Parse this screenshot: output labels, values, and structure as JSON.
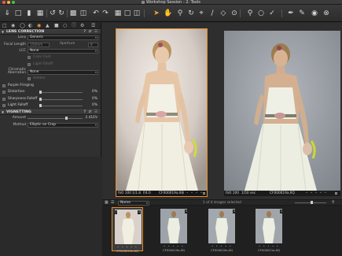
{
  "window": {
    "title": "Workshop Session - 2. Tools"
  },
  "toolbar": {
    "icons": [
      "import-icon",
      "folder-icon",
      "layout-icon",
      "crop-icon",
      "rotate-left-icon",
      "rotate-right-icon",
      "browser-icon",
      "trash-icon",
      "undo-icon",
      "redo-icon",
      "grid-icon",
      "single-view-icon",
      "multi-view-icon",
      "hand-icon",
      "zoom-icon",
      "rotate-tool-icon",
      "crop-tool-icon",
      "straighten-icon",
      "keystone-icon",
      "spot-icon",
      "picker-icon",
      "search-icon",
      "loupe-icon",
      "brush-icon",
      "eraser-icon",
      "camera-icon",
      "process-icon"
    ]
  },
  "left_panel": {
    "tabs": [
      "library-tab",
      "capture-tab",
      "color-tab",
      "exposure-tab",
      "lens-tab",
      "detail-tab",
      "adjustments-tab",
      "output-tab",
      "metadata-tab",
      "settings-tab"
    ],
    "lens_correction": {
      "header": "LENS CORRECTION",
      "lens_label": "Lens",
      "lens_value": "Generic",
      "focal_label": "Focal Length",
      "focal_value": "150mm",
      "aperture_label": "Aperture",
      "aperture_value": "8",
      "lcc_label": "LCC",
      "lcc_value": "None",
      "color_cast": "Color Cast",
      "light_falloff_opt": "Light Falloff",
      "chromatic_label": "Chromatic Aberration",
      "chromatic_value": "None",
      "hidden_label": "Hidden",
      "purple_fringing": "Purple Fringing",
      "distortion": "Distortion",
      "distortion_value": "0%",
      "sharpness": "Sharpness Falloff",
      "sharpness_value": "0%",
      "light_falloff": "Light Falloff",
      "light_falloff_value": "0%"
    },
    "vignetting": {
      "header": "VIGNETTING",
      "amount_label": "Amount",
      "amount_value": "2.41EV",
      "method_label": "Method",
      "method_value": "Elliptic on Crop"
    }
  },
  "viewer": {
    "left_status": {
      "iso": "ISO 100",
      "shutter": "1/1.8",
      "aperture": "f/4.0",
      "filename": "CF000019a.IIQ"
    },
    "right_status": {
      "iso": "ISO 100",
      "shutter": "1/50 sec",
      "filename": "CF000019a.IIQ"
    }
  },
  "filmstrip": {
    "sort_label": "Name",
    "count_text": "1 of 4 images selected",
    "thumbs": [
      {
        "name": "CF000019a.IIQ",
        "badge": "1"
      },
      {
        "name": "CF000019a.IIQ",
        "badge": "1"
      },
      {
        "name": "CF000020a.IIQ",
        "badge": "1"
      },
      {
        "name": "CF000021a.IIQ",
        "badge": "1"
      }
    ],
    "stars": "• • • • •"
  },
  "colors": {
    "accent": "#e58f2c",
    "background": "#2b2b2b"
  }
}
